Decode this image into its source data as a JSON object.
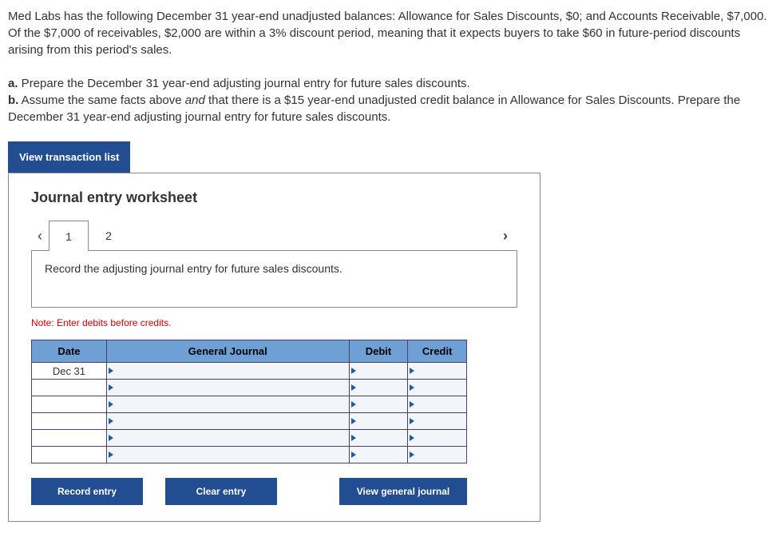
{
  "problem": {
    "p1": "Med Labs has the following December 31 year-end unadjusted balances: Allowance for Sales Discounts, $0; and Accounts Receivable, $7,000. Of the $7,000 of receivables, $2,000 are within a 3% discount period, meaning that it expects buyers to take $60 in future-period discounts arising from this period's sales.",
    "a_label": "a.",
    "a_text": " Prepare the December 31 year-end adjusting journal entry for future sales discounts.",
    "b_label": "b.",
    "b_text_1": " Assume the same facts above ",
    "b_and": "and",
    "b_text_2": " that there is a $15 year-end unadjusted credit balance in Allowance for Sales Discounts. Prepare the December 31 year-end adjusting journal entry for future sales discounts."
  },
  "buttons": {
    "view_transaction_list": "View transaction list",
    "record_entry": "Record entry",
    "clear_entry": "Clear entry",
    "view_general_journal": "View general journal"
  },
  "worksheet": {
    "title": "Journal entry worksheet",
    "tabs": [
      "1",
      "2"
    ],
    "instruction": "Record the adjusting journal entry for future sales discounts.",
    "note": "Note: Enter debits before credits.",
    "headers": {
      "date": "Date",
      "general_journal": "General Journal",
      "debit": "Debit",
      "credit": "Credit"
    },
    "rows": [
      {
        "date": "Dec 31",
        "gj": "",
        "debit": "",
        "credit": ""
      },
      {
        "date": "",
        "gj": "",
        "debit": "",
        "credit": ""
      },
      {
        "date": "",
        "gj": "",
        "debit": "",
        "credit": ""
      },
      {
        "date": "",
        "gj": "",
        "debit": "",
        "credit": ""
      },
      {
        "date": "",
        "gj": "",
        "debit": "",
        "credit": ""
      },
      {
        "date": "",
        "gj": "",
        "debit": "",
        "credit": ""
      }
    ]
  }
}
